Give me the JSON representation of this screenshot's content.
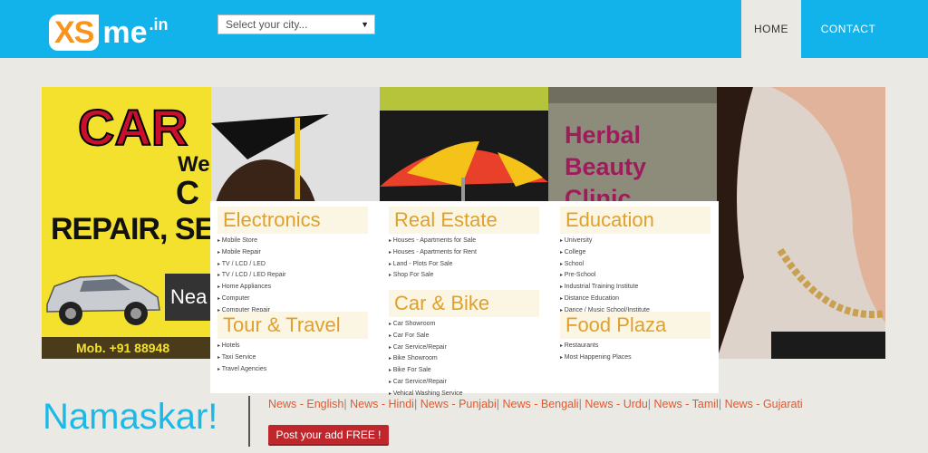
{
  "logo": {
    "xs": "XS",
    "me": "me",
    "dotin": ".in"
  },
  "city_select": {
    "value": "Select your city...",
    "arrow": "▼"
  },
  "nav": {
    "home": "HOME",
    "contact": "CONTACT"
  },
  "banner": {
    "car_big": "CAR",
    "car_we": "We",
    "car_c": "C",
    "car_repair": "REPAIR, SER",
    "car_near": "Nea",
    "car_mobile": "Mob. +91 88948",
    "herbal": [
      "Herbal",
      "Beauty",
      "Clinic"
    ]
  },
  "categories": [
    {
      "title": "Electronics",
      "items": [
        "Mobile Store",
        "Mobile Repair",
        "TV / LCD / LED",
        "TV / LCD / LED Repair",
        "Home Appliances",
        "Computer",
        "Computer Repair"
      ]
    },
    {
      "title": "Real Estate",
      "items": [
        "Houses - Apartments for Sale",
        "Houses - Apartments for Rent",
        "Land - Plots For Sale",
        "Shop For Sale"
      ]
    },
    {
      "title": "Education",
      "items": [
        "University",
        "College",
        "School",
        "Pre-School",
        "Industrial Training Institute",
        "Distance Education",
        "Dance / Music School/Institute"
      ]
    },
    {
      "title": "Tour & Travel",
      "items": [
        "Hotels",
        "Taxi Service",
        "Travel Agencies"
      ]
    },
    {
      "title": "Car & Bike",
      "items": [
        "Car Showroom",
        "Car For Sale",
        "Car Service/Repair",
        "Bike Showroom",
        "Bike For Sale",
        "Car Service/Repair",
        "Vehical Washing Service"
      ]
    },
    {
      "title": "Food Plaza",
      "items": [
        "Restaurants",
        "Most Happening Places"
      ]
    }
  ],
  "greeting": "Namaskar!",
  "news_links": [
    "News - English",
    "News - Hindi",
    "News - Punjabi",
    "News - Bengali",
    "News - Urdu",
    "News - Tamil",
    "News - Gujarati"
  ],
  "post_button": "Post your add FREE !",
  "colors": {
    "header": "#12b2ea",
    "logo_orange": "#f7941d",
    "category_title": "#e0a02c",
    "news_link": "#e8562a",
    "post_button": "#c0272d",
    "greeting": "#1cb8e8"
  }
}
